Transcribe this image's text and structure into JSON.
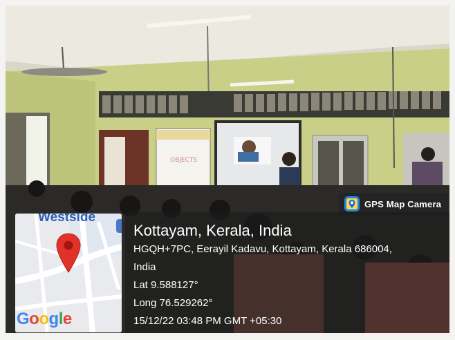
{
  "app": {
    "badge_label": "GPS Map Camera",
    "badge_icon": "gps-map-camera-icon"
  },
  "map": {
    "place_label": "Westside",
    "logo_letters": [
      "G",
      "o",
      "o",
      "g",
      "l",
      "e"
    ],
    "pin_color": "#e1322a"
  },
  "location": {
    "title": "Kottayam, Kerala, India",
    "address_line1": "HGQH+7PC, Eerayil Kadavu, Kottayam, Kerala 686004,",
    "address_line2": "India",
    "latitude": "Lat 9.588127°",
    "longitude": "Long 76.529262°",
    "timestamp": "15/12/22 03:48 PM GMT +05:30"
  },
  "colors": {
    "wall": "#c8cf83",
    "ceiling": "#ecebe2",
    "overlay": "#1c1c1c"
  }
}
